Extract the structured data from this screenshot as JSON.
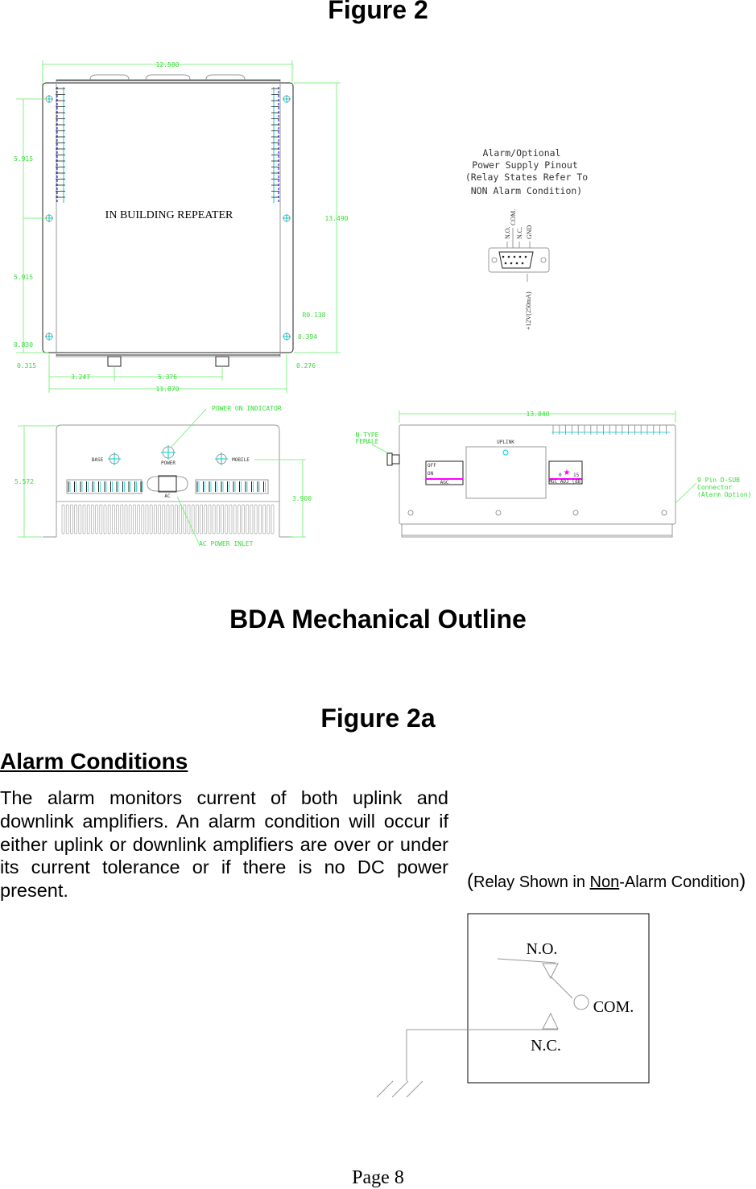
{
  "figure_title": "Figure 2",
  "top_view": {
    "label": "IN BUILDING REPEATER",
    "dimensions": {
      "width_total": "12.500",
      "height_total": "13.490",
      "hole_spacing_1": "5.915",
      "hole_spacing_2": "5.915",
      "hole_offset_bottom": "0.830",
      "left_offset": "0.315",
      "foot_1": "3.247",
      "foot_spacing": "5.376",
      "hole_span": "11.870",
      "right_offset": "0.276",
      "radius": "R0.138",
      "hole_height": "0.394"
    }
  },
  "pinout": {
    "caption": [
      "Alarm/Optional",
      "Power Supply Pinout",
      "(Relay States Refer To",
      "NON Alarm Condition)"
    ],
    "pins": [
      "N.O.",
      "COM.",
      "N.C.",
      "GND"
    ],
    "power": "+12V(250mA)"
  },
  "front_view": {
    "base": "BASE",
    "mobile": "MOBILE",
    "power": "POWER",
    "ac": "AC",
    "power_indicator": "POWER ON INDICATOR",
    "ac_inlet": "AC POWER INLET",
    "height": "5.572",
    "sub_height": "3.900"
  },
  "side_view": {
    "length": "13.840",
    "ntype": [
      "N-TYPE",
      "FEMALE"
    ],
    "uplink": "UPLINK",
    "agc": "AGC",
    "off": "OFF",
    "on": "ON",
    "mgc": "MGC ADJ (dB)",
    "mgc_min": "0",
    "mgc_max": "15",
    "dsub": [
      "9 Pin D-SUB",
      "Connector",
      "(Alarm Option)"
    ]
  },
  "outline_title": "BDA Mechanical Outline",
  "figure2a_title": "Figure 2a",
  "section_heading": "Alarm Conditions",
  "paragraph": "The alarm monitors current of both uplink and downlink amplifiers. An alarm condition will occur if either uplink or downlink amplifiers are over or under its current tolerance or if there is no DC power present.",
  "relay_caption": {
    "open": "(",
    "pre": "Relay Shown in ",
    "under": "Non",
    "post": "-Alarm Condition",
    ",close": ")",
    "close": ")"
  },
  "relay": {
    "no": "N.O.",
    "com": "COM.",
    "nc": "N.C."
  },
  "page_number": "Page 8",
  "colors": {
    "dimension": "#33dd33",
    "centerline": "#00cccc",
    "indicator": "#ff00ff"
  }
}
